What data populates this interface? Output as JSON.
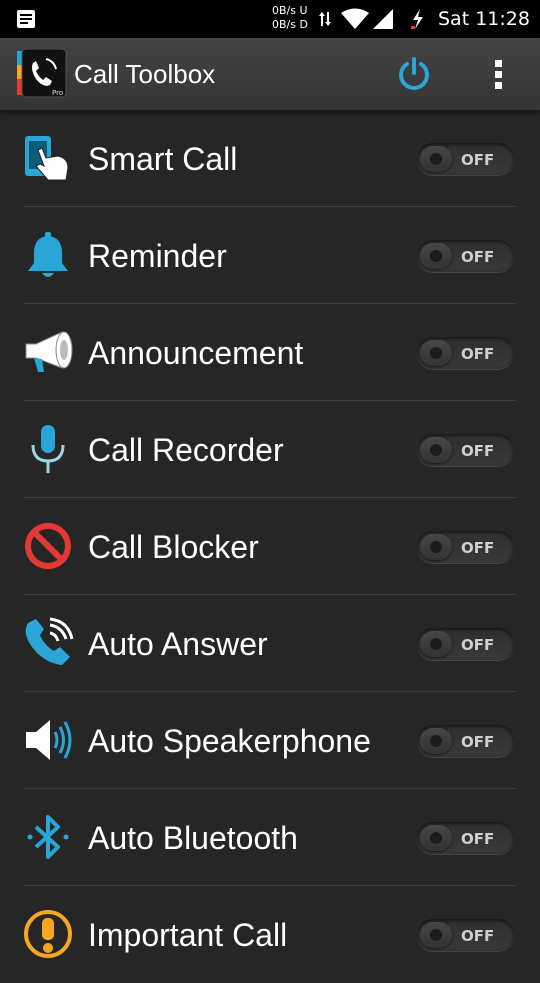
{
  "status_bar": {
    "net_up": "0B/s U",
    "net_down": "0B/s D",
    "time": "Sat 11:28",
    "icons": [
      "notification-icon",
      "data-arrows-icon",
      "wifi-icon",
      "cell-signal-icon",
      "battery-charging-icon"
    ]
  },
  "app_bar": {
    "title": "Call Toolbox",
    "logo_badge": "Pro",
    "accent_color": "#2aa6d6"
  },
  "features": [
    {
      "label": "Smart Call",
      "icon": "smart-call-icon",
      "state": "OFF"
    },
    {
      "label": "Reminder",
      "icon": "bell-icon",
      "state": "OFF"
    },
    {
      "label": "Announcement",
      "icon": "megaphone-icon",
      "state": "OFF"
    },
    {
      "label": "Call Recorder",
      "icon": "microphone-icon",
      "state": "OFF"
    },
    {
      "label": "Call Blocker",
      "icon": "block-icon",
      "state": "OFF"
    },
    {
      "label": "Auto Answer",
      "icon": "phone-ringing-icon",
      "state": "OFF"
    },
    {
      "label": "Auto Speakerphone",
      "icon": "speaker-icon",
      "state": "OFF"
    },
    {
      "label": "Auto Bluetooth",
      "icon": "bluetooth-icon",
      "state": "OFF"
    },
    {
      "label": "Important Call",
      "icon": "alert-icon",
      "state": "OFF"
    }
  ]
}
